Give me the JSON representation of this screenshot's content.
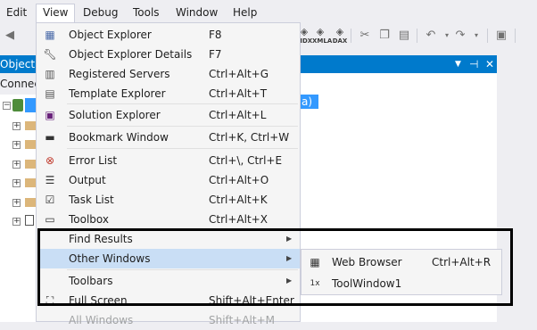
{
  "menubar": {
    "items": [
      "Edit",
      "View",
      "Debug",
      "Tools",
      "Window",
      "Help"
    ]
  },
  "toolbar": {
    "mdx_label": "MDX",
    "xmla_label": "XMLA",
    "dax_label": "DAX"
  },
  "object_explorer": {
    "title": "Object Ex",
    "connect_label": "Connect",
    "root_suffix": "a)"
  },
  "view_menu": {
    "items": [
      {
        "label": "Object Explorer",
        "shortcut": "F8",
        "icon": "object-explorer-icon"
      },
      {
        "label": "Object Explorer Details",
        "shortcut": "F7",
        "icon": "wrench-icon"
      },
      {
        "label": "Registered Servers",
        "shortcut": "Ctrl+Alt+G",
        "icon": "registered-servers-icon"
      },
      {
        "label": "Template Explorer",
        "shortcut": "Ctrl+Alt+T",
        "icon": "template-explorer-icon"
      },
      {
        "label": "Solution Explorer",
        "shortcut": "Ctrl+Alt+L",
        "icon": "solution-explorer-icon"
      },
      {
        "label": "Bookmark Window",
        "shortcut": "Ctrl+K, Ctrl+W",
        "icon": "bookmark-icon"
      },
      {
        "label": "Error List",
        "shortcut": "Ctrl+\\, Ctrl+E",
        "icon": "error-list-icon"
      },
      {
        "label": "Output",
        "shortcut": "Ctrl+Alt+O",
        "icon": "output-icon"
      },
      {
        "label": "Task List",
        "shortcut": "Ctrl+Alt+K",
        "icon": "task-list-icon"
      },
      {
        "label": "Toolbox",
        "shortcut": "Ctrl+Alt+X",
        "icon": "toolbox-icon"
      },
      {
        "label": "Find Results",
        "shortcut": "",
        "icon": ""
      },
      {
        "label": "Other Windows",
        "shortcut": "",
        "icon": ""
      },
      {
        "label": "Toolbars",
        "shortcut": "",
        "icon": ""
      },
      {
        "label": "Full Screen",
        "shortcut": "Shift+Alt+Enter",
        "icon": "full-screen-icon"
      },
      {
        "label": "All Windows",
        "shortcut": "Shift+Alt+M",
        "icon": ""
      }
    ]
  },
  "submenu": {
    "items": [
      {
        "label": "Web Browser",
        "shortcut": "Ctrl+Alt+R",
        "icon": "web-browser-icon"
      },
      {
        "label": "ToolWindow1",
        "shortcut": "",
        "icon_text": "1x"
      }
    ]
  },
  "colors": {
    "accent": "#007acc",
    "menu_hover": "#c9def5",
    "highlight_border": "#000000"
  }
}
